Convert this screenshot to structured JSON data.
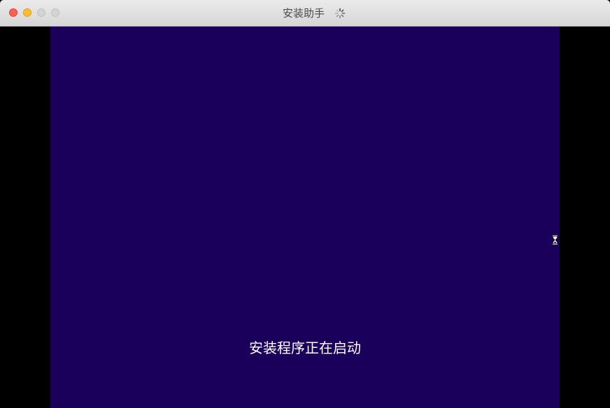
{
  "window": {
    "title": "安装助手"
  },
  "titlebar": {
    "buttons": [
      "close",
      "minimize",
      "zoom",
      "extra"
    ],
    "activity_indicator": "spinner-icon"
  },
  "installer": {
    "status_text": "安装程序正在启动",
    "background_color": "#1b005b"
  },
  "cursor": {
    "icon": "hourglass-icon"
  }
}
